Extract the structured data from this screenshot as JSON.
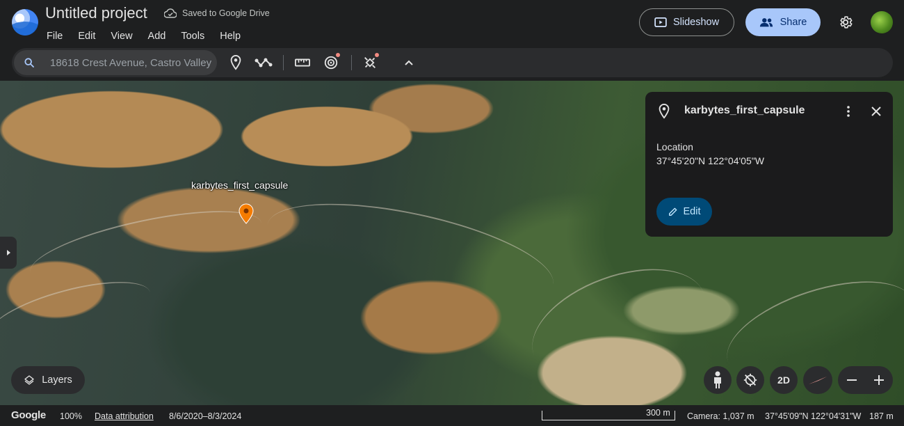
{
  "app": {
    "title": "Untitled project",
    "saved_status": "Saved to Google Drive"
  },
  "menu": [
    "File",
    "Edit",
    "View",
    "Add",
    "Tools",
    "Help"
  ],
  "header": {
    "slideshow_label": "Slideshow",
    "share_label": "Share"
  },
  "search": {
    "value": "18618 Crest Avenue, Castro Valley"
  },
  "map": {
    "placemark_label": "karbytes_first_capsule",
    "layers_label": "Layers",
    "view_mode_label": "2D"
  },
  "info_card": {
    "title": "karbytes_first_capsule",
    "location_label": "Location",
    "location_value": "37°45'20\"N 122°04'05\"W",
    "edit_label": "Edit"
  },
  "status_bar": {
    "google": "Google",
    "zoom": "100%",
    "attribution": "Data attribution",
    "imagery_dates": "8/6/2020–8/3/2024",
    "scale": "300 m",
    "camera": "Camera: 1,037 m",
    "coordinates": "37°45'09\"N 122°04'31\"W",
    "elevation": "187 m"
  },
  "colors": {
    "accent": "#a8c7fa",
    "background": "#1e1f20",
    "pin": "#f57c00",
    "edit_button": "#004a77"
  }
}
